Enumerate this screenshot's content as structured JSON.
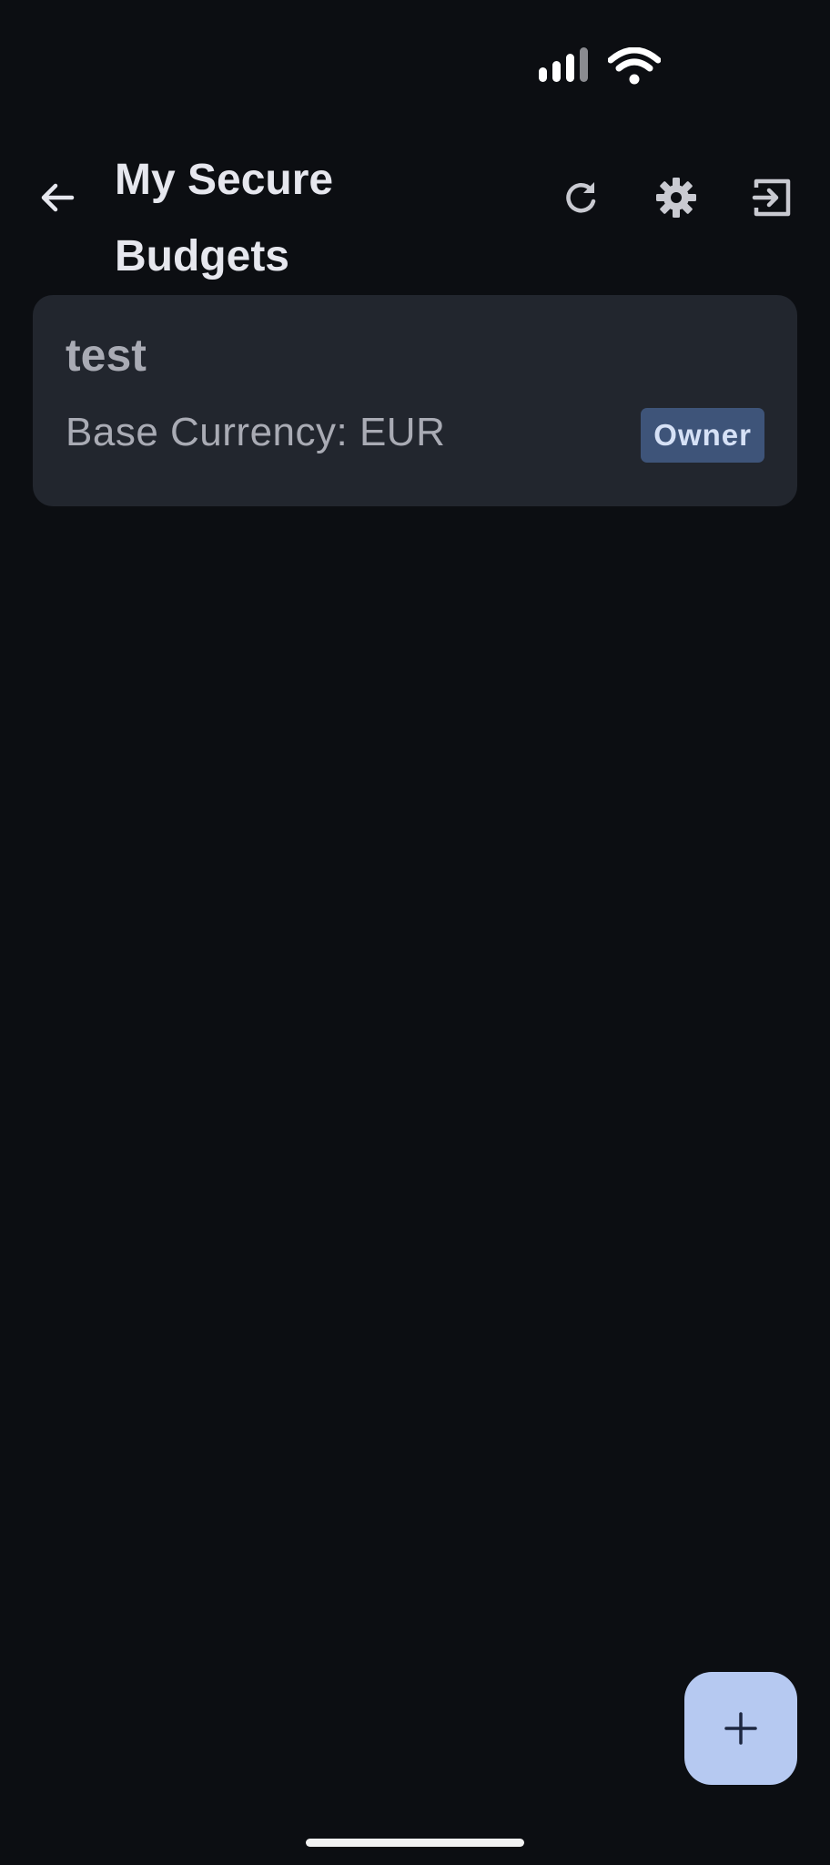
{
  "status_bar": {
    "icons": [
      "signal-icon",
      "wifi-icon"
    ]
  },
  "header": {
    "title": "My Secure Budgets",
    "back_icon": "arrow-left-icon",
    "actions": [
      {
        "name": "refresh",
        "icon": "refresh-icon"
      },
      {
        "name": "settings",
        "icon": "gear-icon"
      },
      {
        "name": "logout",
        "icon": "logout-icon"
      }
    ]
  },
  "budgets": [
    {
      "name": "test",
      "currency_text": "Base Currency: EUR",
      "role": "Owner"
    }
  ],
  "fab": {
    "icon": "plus-icon"
  },
  "colors": {
    "background": "#0c0e12",
    "card": "#22262e",
    "badge": "#3e5479",
    "badge_text": "#d6e1f6",
    "fab": "#b6c9f1",
    "title": "#e6e7ee",
    "muted_text": "#a9abb4"
  }
}
